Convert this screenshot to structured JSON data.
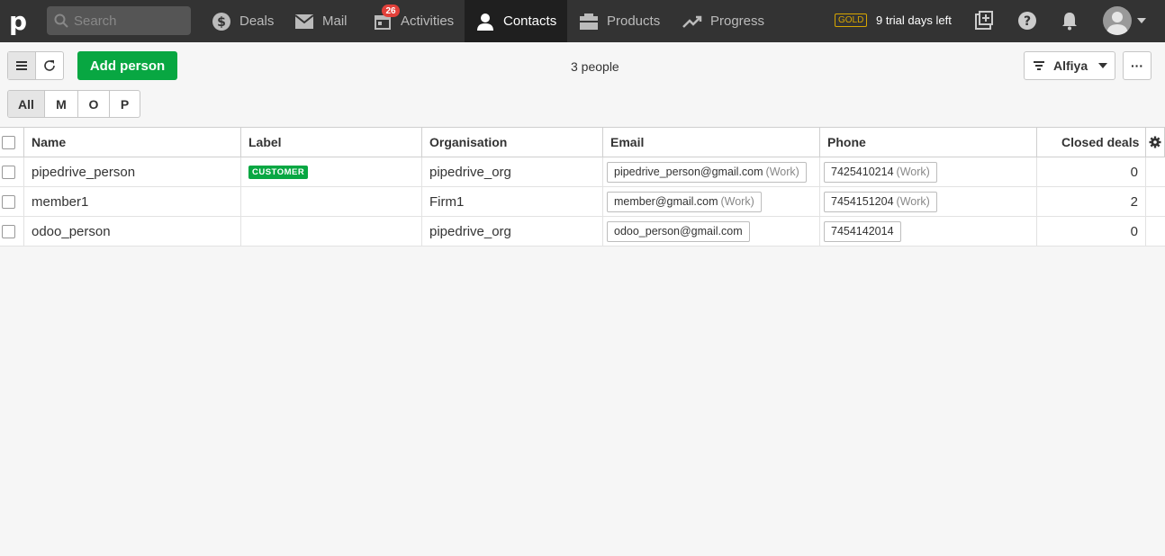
{
  "nav": {
    "logo": "p",
    "search_placeholder": "Search",
    "items": [
      {
        "label": "Deals",
        "icon": "dollar-icon"
      },
      {
        "label": "Mail",
        "icon": "mail-icon"
      },
      {
        "label": "Activities",
        "icon": "calendar-icon",
        "badge": "26"
      },
      {
        "label": "Contacts",
        "icon": "person-icon",
        "active": true
      },
      {
        "label": "Products",
        "icon": "box-icon"
      },
      {
        "label": "Progress",
        "icon": "trend-icon"
      }
    ],
    "plan_badge": "GOLD",
    "trial_text": "9 trial days left"
  },
  "toolbar": {
    "add_label": "Add person",
    "count_text": "3 people",
    "filter_label": "Alfiya",
    "more_label": "···"
  },
  "letters": [
    "All",
    "M",
    "O",
    "P"
  ],
  "table": {
    "headers": {
      "name": "Name",
      "label": "Label",
      "org": "Organisation",
      "email": "Email",
      "phone": "Phone",
      "deals": "Closed deals"
    },
    "rows": [
      {
        "name": "pipedrive_person",
        "label": "CUSTOMER",
        "org": "pipedrive_org",
        "email": "pipedrive_person@gmail.com",
        "email_type": "(Work)",
        "phone": "7425410214",
        "phone_type": "(Work)",
        "deals": "0"
      },
      {
        "name": "member1",
        "label": "",
        "org": "Firm1",
        "email": "member@gmail.com",
        "email_type": "(Work)",
        "phone": "7454151204",
        "phone_type": "(Work)",
        "deals": "2"
      },
      {
        "name": "odoo_person",
        "label": "",
        "org": "pipedrive_org",
        "email": "odoo_person@gmail.com",
        "email_type": "",
        "phone": "7454142014",
        "phone_type": "",
        "deals": "0"
      }
    ]
  },
  "colors": {
    "accent": "#08a742",
    "nav_bg": "#333333",
    "badge": "#e2403a",
    "gold": "#d7a600"
  }
}
